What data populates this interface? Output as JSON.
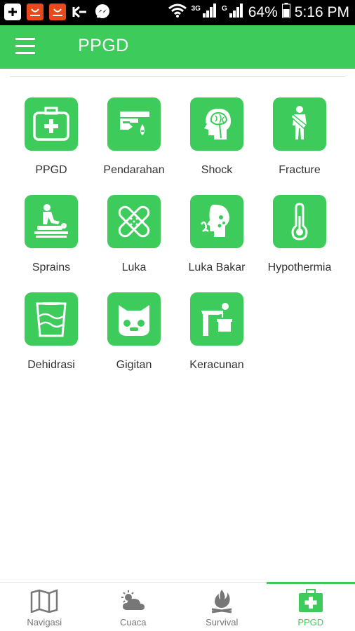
{
  "status_bar": {
    "battery": "64%",
    "time": "5:16 PM",
    "network_1": "3G",
    "network_2": "G",
    "icons": [
      "add-box-icon",
      "aliexpress-icon",
      "aliexpress-icon",
      "kaskus-icon",
      "messenger-icon",
      "wifi-icon",
      "signal-icon",
      "signal-icon",
      "battery-icon"
    ]
  },
  "app_bar": {
    "title": "PPGD",
    "menu_icon": "hamburger-menu-icon"
  },
  "colors": {
    "accent": "#3dcc5c",
    "text": "#333333",
    "nav_inactive": "#777777"
  },
  "grid": {
    "items": [
      {
        "label": "PPGD",
        "icon": "first-aid-kit-icon"
      },
      {
        "label": "Pendarahan",
        "icon": "bleeding-hand-icon"
      },
      {
        "label": "Shock",
        "icon": "head-brain-icon"
      },
      {
        "label": "Fracture",
        "icon": "arm-sling-icon"
      },
      {
        "label": "Sprains",
        "icon": "massage-icon"
      },
      {
        "label": "Luka",
        "icon": "bandage-icon"
      },
      {
        "label": "Luka Bakar",
        "icon": "burn-face-icon"
      },
      {
        "label": "Hypothermia",
        "icon": "thermometer-icon"
      },
      {
        "label": "Dehidrasi",
        "icon": "water-glass-icon"
      },
      {
        "label": "Gigitan",
        "icon": "animal-face-icon"
      },
      {
        "label": "Keracunan",
        "icon": "vomiting-person-icon"
      }
    ]
  },
  "bottom_nav": {
    "items": [
      {
        "label": "Navigasi",
        "icon": "map-icon",
        "active": false
      },
      {
        "label": "Cuaca",
        "icon": "weather-icon",
        "active": false
      },
      {
        "label": "Survival",
        "icon": "campfire-icon",
        "active": false
      },
      {
        "label": "PPGD",
        "icon": "first-aid-kit-icon",
        "active": true
      }
    ]
  }
}
